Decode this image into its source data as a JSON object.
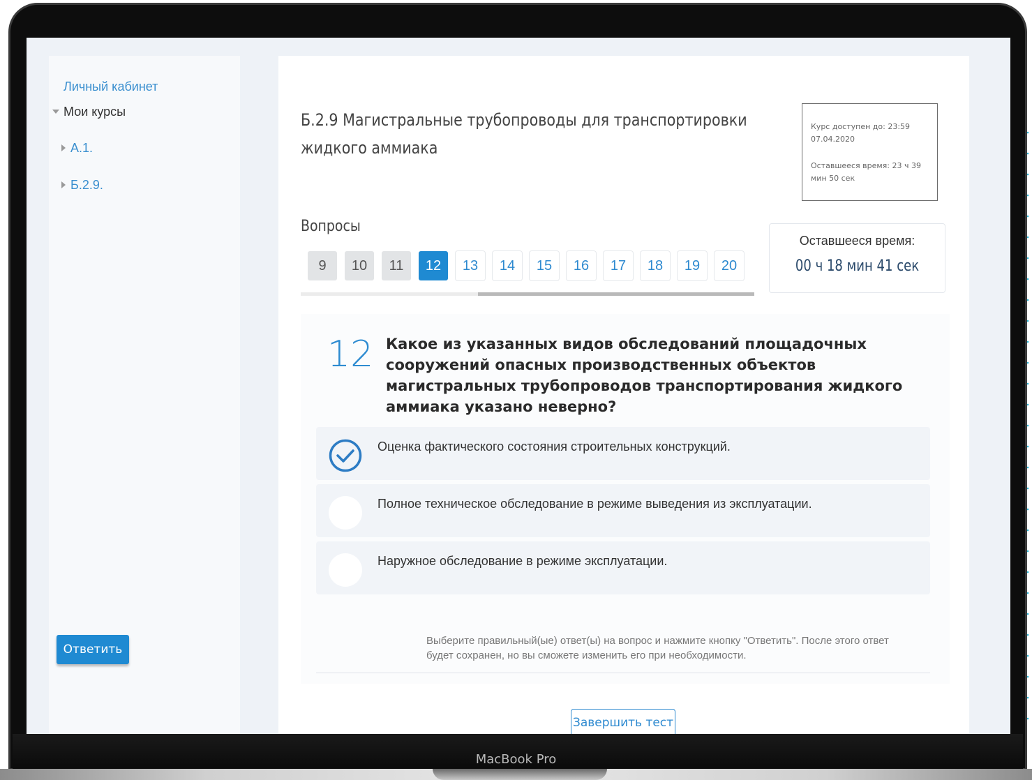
{
  "sidebar": {
    "cabinet_link": "Личный кабинет",
    "my_courses": "Мои курсы",
    "courses": [
      "А.1.",
      "Б.2.9."
    ]
  },
  "header": {
    "course_title": "Б.2.9 Магистральные трубопроводы для транспортировки жидкого аммиака",
    "available_until": "Курс доступен до: 23:59 07.04.2020",
    "remaining_course_time": "Оставшееся время: 23 ч 39 мин 50 сек"
  },
  "questions": {
    "label": "Вопросы",
    "numbers": [
      "9",
      "10",
      "11",
      "12",
      "13",
      "14",
      "15",
      "16",
      "17",
      "18",
      "19",
      "20"
    ],
    "current": "12"
  },
  "timer": {
    "label": "Оставшееся время:",
    "value": "00 ч 18 мин 41 сек"
  },
  "question": {
    "number": "12",
    "text": "Какое из указанных видов обследований площадочных сооружений опасных производственных объектов магистральных трубопроводов транспортирования жидкого аммиака указано неверно?",
    "answers": [
      {
        "text": "Оценка фактического состояния строительных конструкций.",
        "checked": true
      },
      {
        "text": "Полное техническое обследование в режиме выведения из эксплуатации.",
        "checked": false
      },
      {
        "text": "Наружное обследование в режиме эксплуатации.",
        "checked": false
      }
    ]
  },
  "actions": {
    "answer_button": "Ответить",
    "hint": "Выберите правильный(ые) ответ(ы) на вопрос и нажмите кнопку \"Ответить\". После этого ответ будет сохранен, но вы сможете изменить его при необходимости.",
    "finish_button": "Завершить тест"
  },
  "device_label": "MacBook Pro",
  "colors": {
    "accent": "#1f8ad2",
    "link": "#3a8fcf",
    "page_bg": "#eef2f7"
  }
}
